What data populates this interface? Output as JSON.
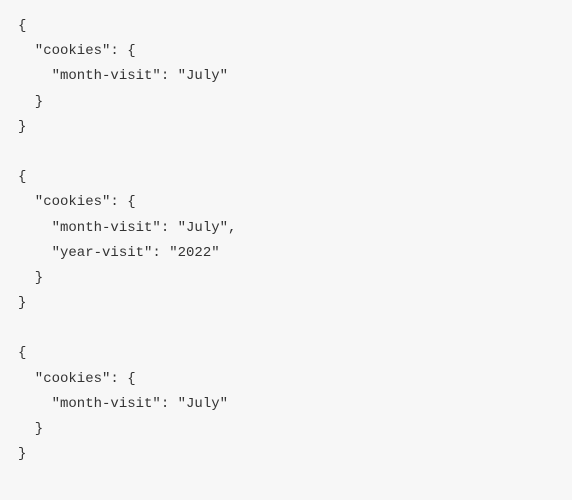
{
  "blocks": [
    {
      "lines": [
        "{",
        "  \"cookies\": {",
        "    \"month-visit\": \"July\"",
        "  }",
        "}"
      ]
    },
    {
      "lines": [
        "{",
        "  \"cookies\": {",
        "    \"month-visit\": \"July\",",
        "    \"year-visit\": \"2022\"",
        "  }",
        "}"
      ]
    },
    {
      "lines": [
        "{",
        "  \"cookies\": {",
        "    \"month-visit\": \"July\"",
        "  }",
        "}"
      ]
    }
  ]
}
